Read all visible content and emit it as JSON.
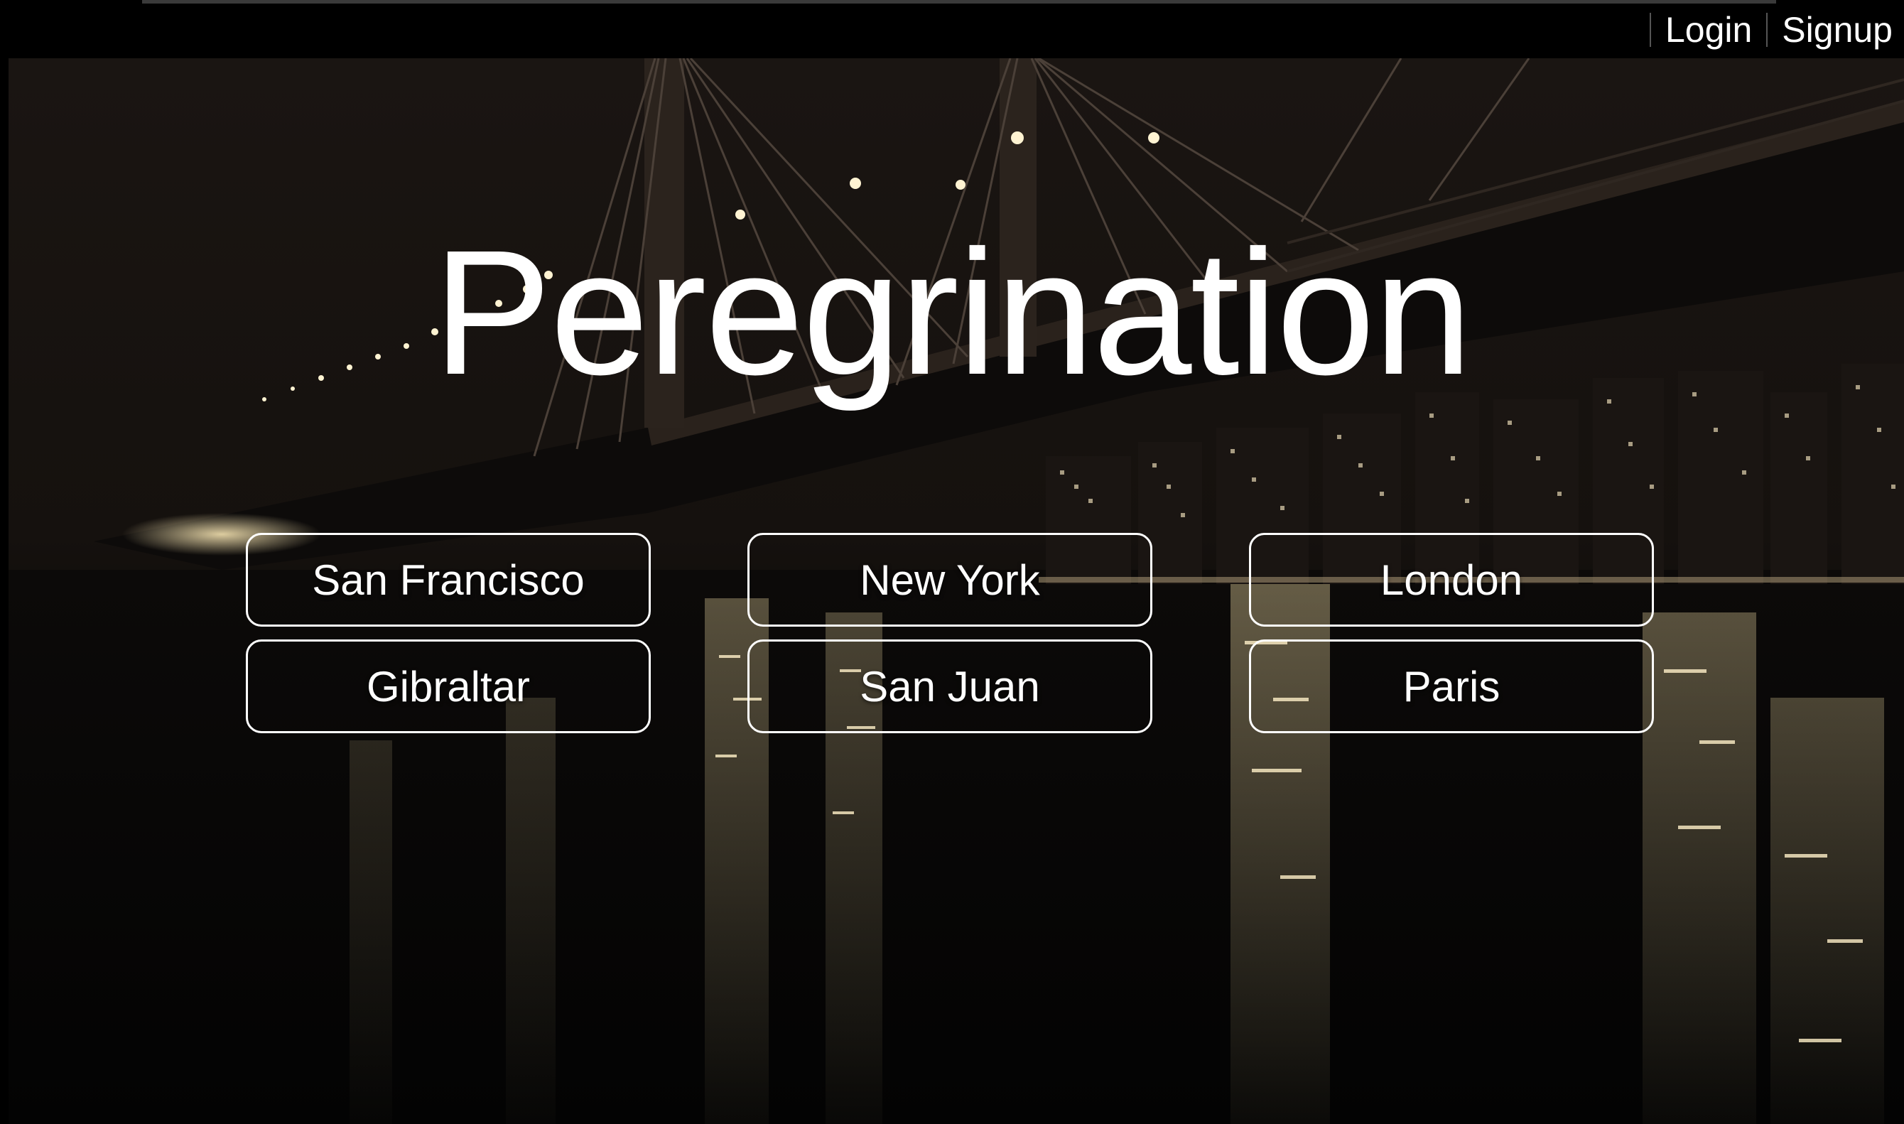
{
  "nav": {
    "login_label": "Login",
    "signup_label": "Signup"
  },
  "hero": {
    "title": "Peregrination",
    "background": "night-bridge-river-image"
  },
  "cities": [
    {
      "label": "San Francisco"
    },
    {
      "label": "New York"
    },
    {
      "label": "London"
    },
    {
      "label": "Gibraltar"
    },
    {
      "label": "San Juan"
    },
    {
      "label": "Paris"
    }
  ],
  "colors": {
    "text": "#ffffff",
    "topbar": "#000000",
    "button_border": "#ffffff"
  }
}
